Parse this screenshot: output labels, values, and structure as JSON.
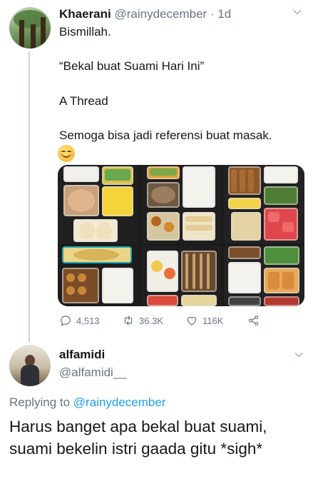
{
  "tweet1": {
    "name": "Khaerani",
    "handle": "@rainydecember",
    "separator": " · ",
    "time": "1d",
    "lines": [
      "Bismillah.",
      "“Bekal buat Suami Hari Ini”",
      "A Thread",
      "Semoga bisa jadi referensi buat masak."
    ],
    "emoji": "smiling-face-emoji",
    "media": "photo-collage-lunchboxes",
    "actions": {
      "reply_count": "4,513",
      "retweet_count": "36.3K",
      "like_count": "116K"
    }
  },
  "tweet2": {
    "name": "alfamidi",
    "handle": "@alfamidi__",
    "replying_prefix": "Replying to ",
    "replying_to": "@rainydecember",
    "text": "Harus banget apa bekal buat suami, suami bekelin istri gaada gitu *sigh*"
  },
  "colors": {
    "text": "#14171a",
    "secondary": "#657786",
    "link": "#1da1f2",
    "thread_line": "#ccd6dd"
  }
}
